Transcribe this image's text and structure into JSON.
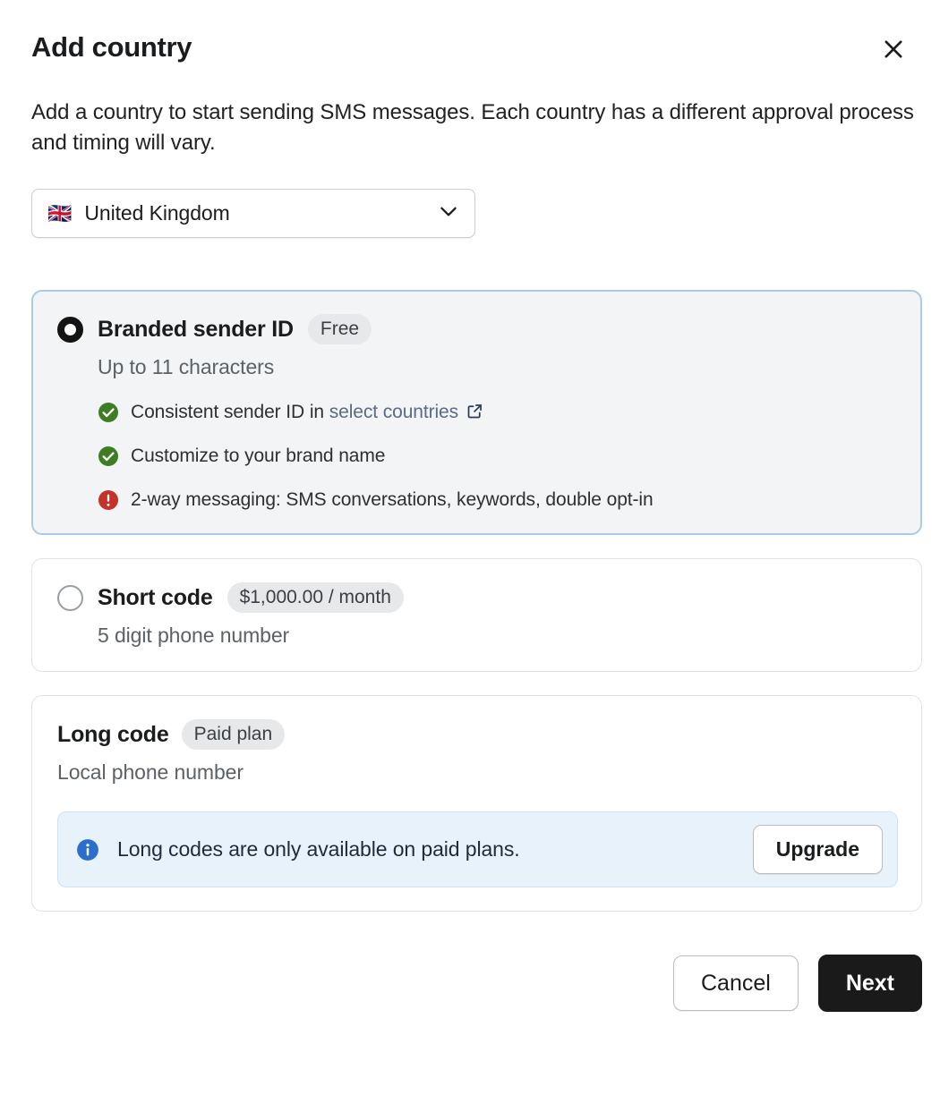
{
  "modal": {
    "title": "Add country",
    "close_icon": "close-icon",
    "description": "Add a country to start sending SMS messages. Each country has a different approval process and timing will vary."
  },
  "country_select": {
    "flag": "🇬🇧",
    "value": "United Kingdom",
    "chevron_icon": "chevron-down-icon"
  },
  "options": [
    {
      "id": "branded-sender-id",
      "title": "Branded sender ID",
      "badge": "Free",
      "subtitle": "Up to 11 characters",
      "selected": true,
      "has_radio": true,
      "features": [
        {
          "status": "check",
          "text_before": "Consistent sender ID in ",
          "link": "select countries",
          "external_link_icon": "external-link-icon"
        },
        {
          "status": "check",
          "text_before": "Customize to your brand name"
        },
        {
          "status": "warning",
          "text_before": "2-way messaging: SMS conversations, keywords, double opt-in"
        }
      ]
    },
    {
      "id": "short-code",
      "title": "Short code",
      "badge": "$1,000.00 / month",
      "subtitle": "5 digit phone number",
      "selected": false,
      "has_radio": true
    },
    {
      "id": "long-code",
      "title": "Long code",
      "badge": "Paid plan",
      "subtitle": "Local phone number",
      "selected": false,
      "has_radio": false,
      "banner": {
        "icon": "info-icon",
        "text": "Long codes are only available on paid plans.",
        "action_label": "Upgrade"
      }
    }
  ],
  "footer": {
    "cancel_label": "Cancel",
    "next_label": "Next"
  },
  "colors": {
    "selected_border": "#a9cbe8",
    "selected_background": "#f3f4f5",
    "check_green": "#3f7d24",
    "warning_red": "#c4332b",
    "info_blue": "#2c6ecb",
    "banner_background": "#e8f2fb",
    "link": "#5a6b85",
    "primary_button": "#1a1a1a"
  }
}
